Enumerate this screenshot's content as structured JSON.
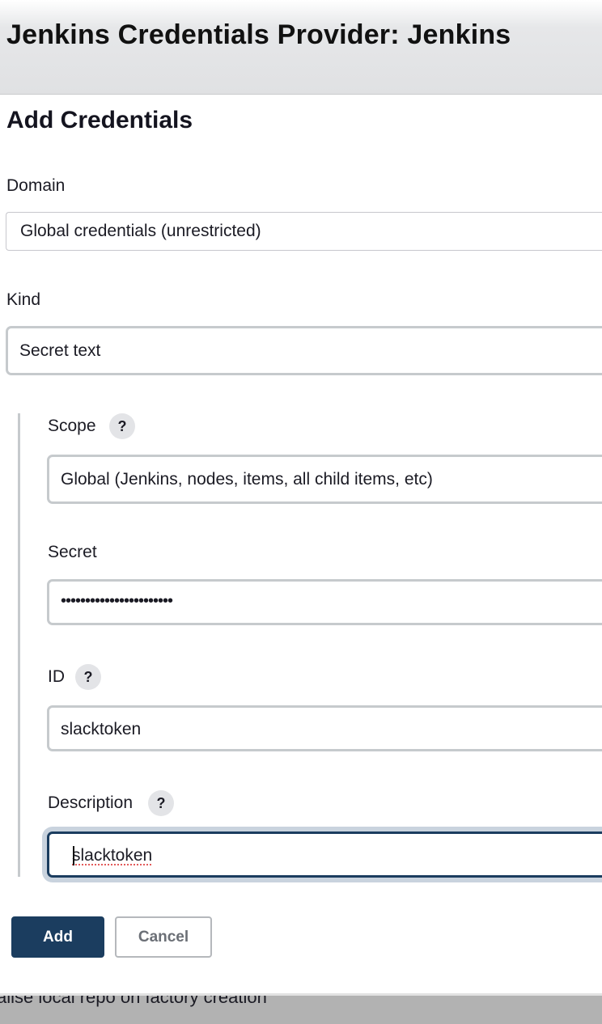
{
  "window": {
    "title": "Jenkins Credentials Provider: Jenkins"
  },
  "dialog": {
    "title": "Add Credentials"
  },
  "domain": {
    "label": "Domain",
    "value": "Global credentials (unrestricted)"
  },
  "kind": {
    "label": "Kind",
    "value": "Secret text"
  },
  "scope": {
    "label": "Scope",
    "value": "Global (Jenkins, nodes, items, all child items, etc)",
    "help_icon": "?"
  },
  "secret": {
    "label": "Secret",
    "value": "•••••••••••••••••••••••"
  },
  "id_field": {
    "label": "ID",
    "value": "slacktoken",
    "help_icon": "?"
  },
  "description": {
    "label": "Description",
    "value": "slacktoken",
    "help_icon": "?"
  },
  "buttons": {
    "add": "Add",
    "cancel": "Cancel"
  },
  "background_page": {
    "peek_text": "alise local repo on factory creation"
  },
  "colors": {
    "primary_button": "#1b3d5f",
    "focus_ring": "#c9d3de",
    "field_border": "#c6cacd"
  },
  "icons": {
    "help": "question-mark-circle"
  }
}
